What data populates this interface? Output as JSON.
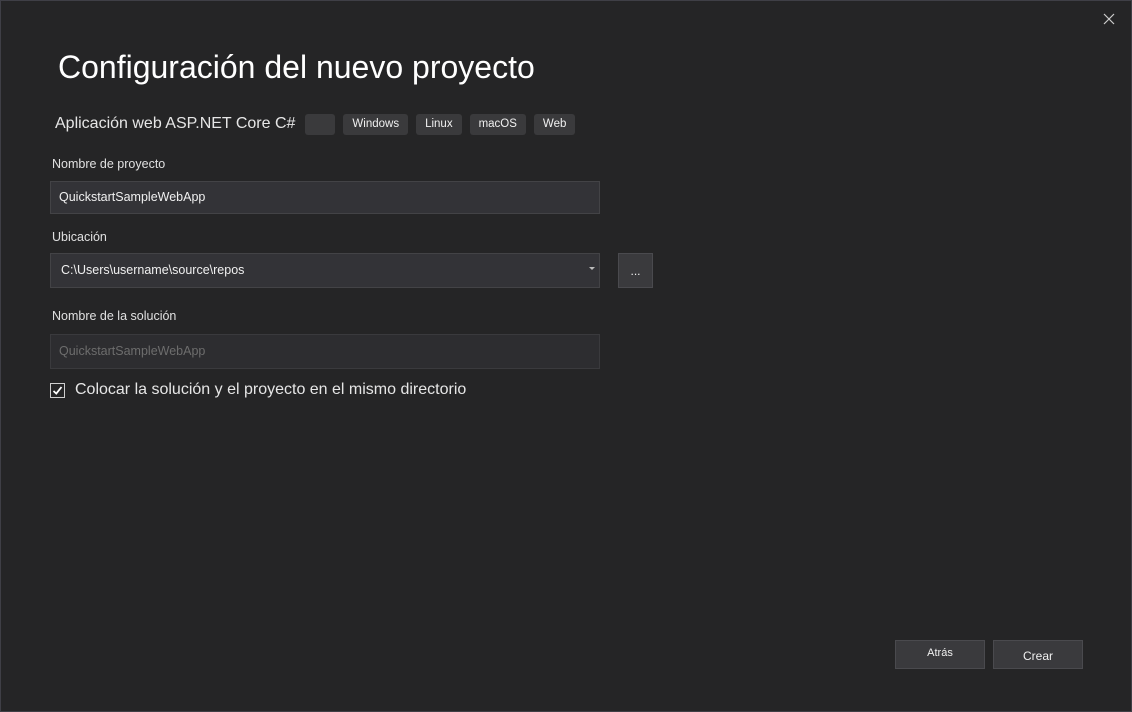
{
  "dialog": {
    "title": "Configuración del nuevo proyecto"
  },
  "template": {
    "name": "Aplicación web ASP.NET Core C#",
    "tags": [
      "",
      "Windows",
      "Linux",
      "macOS",
      "Web"
    ]
  },
  "project_name": {
    "label": "Nombre de proyecto",
    "value": "QuickstartSampleWebApp"
  },
  "location": {
    "label": "Ubicación",
    "value": "C:\\Users\\username\\source\\repos",
    "browse_label": "..."
  },
  "solution_name": {
    "label": "Nombre de la solución",
    "placeholder": "QuickstartSampleWebApp"
  },
  "same_directory": {
    "label": "Colocar la solución y el proyecto en el mismo directorio",
    "checked": true
  },
  "footer": {
    "back_label": "Atrás",
    "create_label": "Crear"
  }
}
